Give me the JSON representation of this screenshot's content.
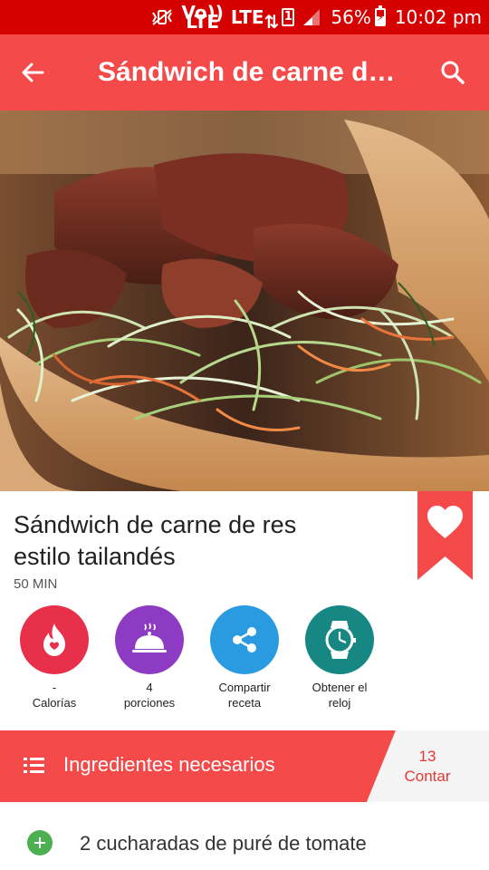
{
  "status_bar": {
    "icons": [
      "vibrate-mute-icon",
      "volte-icon",
      "lte-icon",
      "sim-icon",
      "signal-icon",
      "battery-icon"
    ],
    "volte": "Vo)) LTE",
    "lte": "LTE",
    "sim": "1",
    "battery_percent": "56%",
    "battery_level": 0.56,
    "time": "10:02 pm"
  },
  "app_bar": {
    "title": "Sándwich de carne de res estilo tailandés",
    "back_icon": "back-arrow-icon",
    "search_icon": "search-icon",
    "color": "#f44a4a"
  },
  "recipe": {
    "title_line1": "Sándwich de carne de res",
    "title_line2": "estilo tailandés",
    "time": "50 MIN",
    "favorite_icon": "heart-icon"
  },
  "actions": [
    {
      "icon": "flame-icon",
      "color": "#e8304a",
      "value": "-",
      "label": "Calorías"
    },
    {
      "icon": "cloche-icon",
      "color": "#8e3bc4",
      "value": "4",
      "label": "porciones"
    },
    {
      "icon": "share-icon",
      "color": "#2a9be0",
      "value": "Compartir",
      "label": "receta"
    },
    {
      "icon": "watch-icon",
      "color": "#178783",
      "value": "Obtener el",
      "label": "reloj"
    }
  ],
  "ingredients": {
    "header": "Ingredientes necesarios",
    "count": "13",
    "count_label": "Contar",
    "list_icon": "list-icon",
    "items": [
      {
        "text": "2 cucharadas de puré de tomate",
        "icon": "add-icon"
      }
    ]
  },
  "colors": {
    "status_bar": "#d50000",
    "accent": "#f44a4a",
    "add_green": "#4caf50"
  }
}
